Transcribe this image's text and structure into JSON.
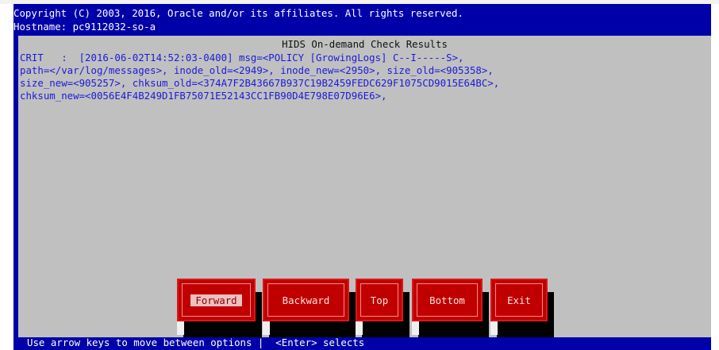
{
  "header": {
    "copyright": "Copyright (C) 2003, 2016, Oracle and/or its affiliates. All rights reserved.",
    "hostname": "Hostname: pc9112032-so-a"
  },
  "results": {
    "title": "HIDS On-demand Check Results",
    "lines": [
      "CRIT   :  [2016-06-02T14:52:03-0400] msg=<POLICY [GrowingLogs] C--I-----S>,",
      "path=</var/log/messages>, inode_old=<2949>, inode_new=<2950>, size_old=<905358>,",
      "size_new=<905257>, chksum_old=<374A7F2B43667B937C19B2459FEDC629F1075CD9015E64BC>,",
      "chksum_new=<0056E4F4B249D1FB75071E52143CC1FB90D4E798E07D96E6>,"
    ]
  },
  "buttons": {
    "forward": "Forward",
    "backward": "Backward",
    "top": "Top",
    "bottom": "Bottom",
    "exit": "Exit",
    "selected": "forward"
  },
  "status": {
    "hint": "Use arrow keys to move between options |  <Enter> selects"
  },
  "colors": {
    "terminal_background": "#0000a8",
    "panel_background": "#c0c0c0",
    "result_text": "#1b1bd8",
    "button_background": "#c00000",
    "status_text": "#ffffff"
  }
}
